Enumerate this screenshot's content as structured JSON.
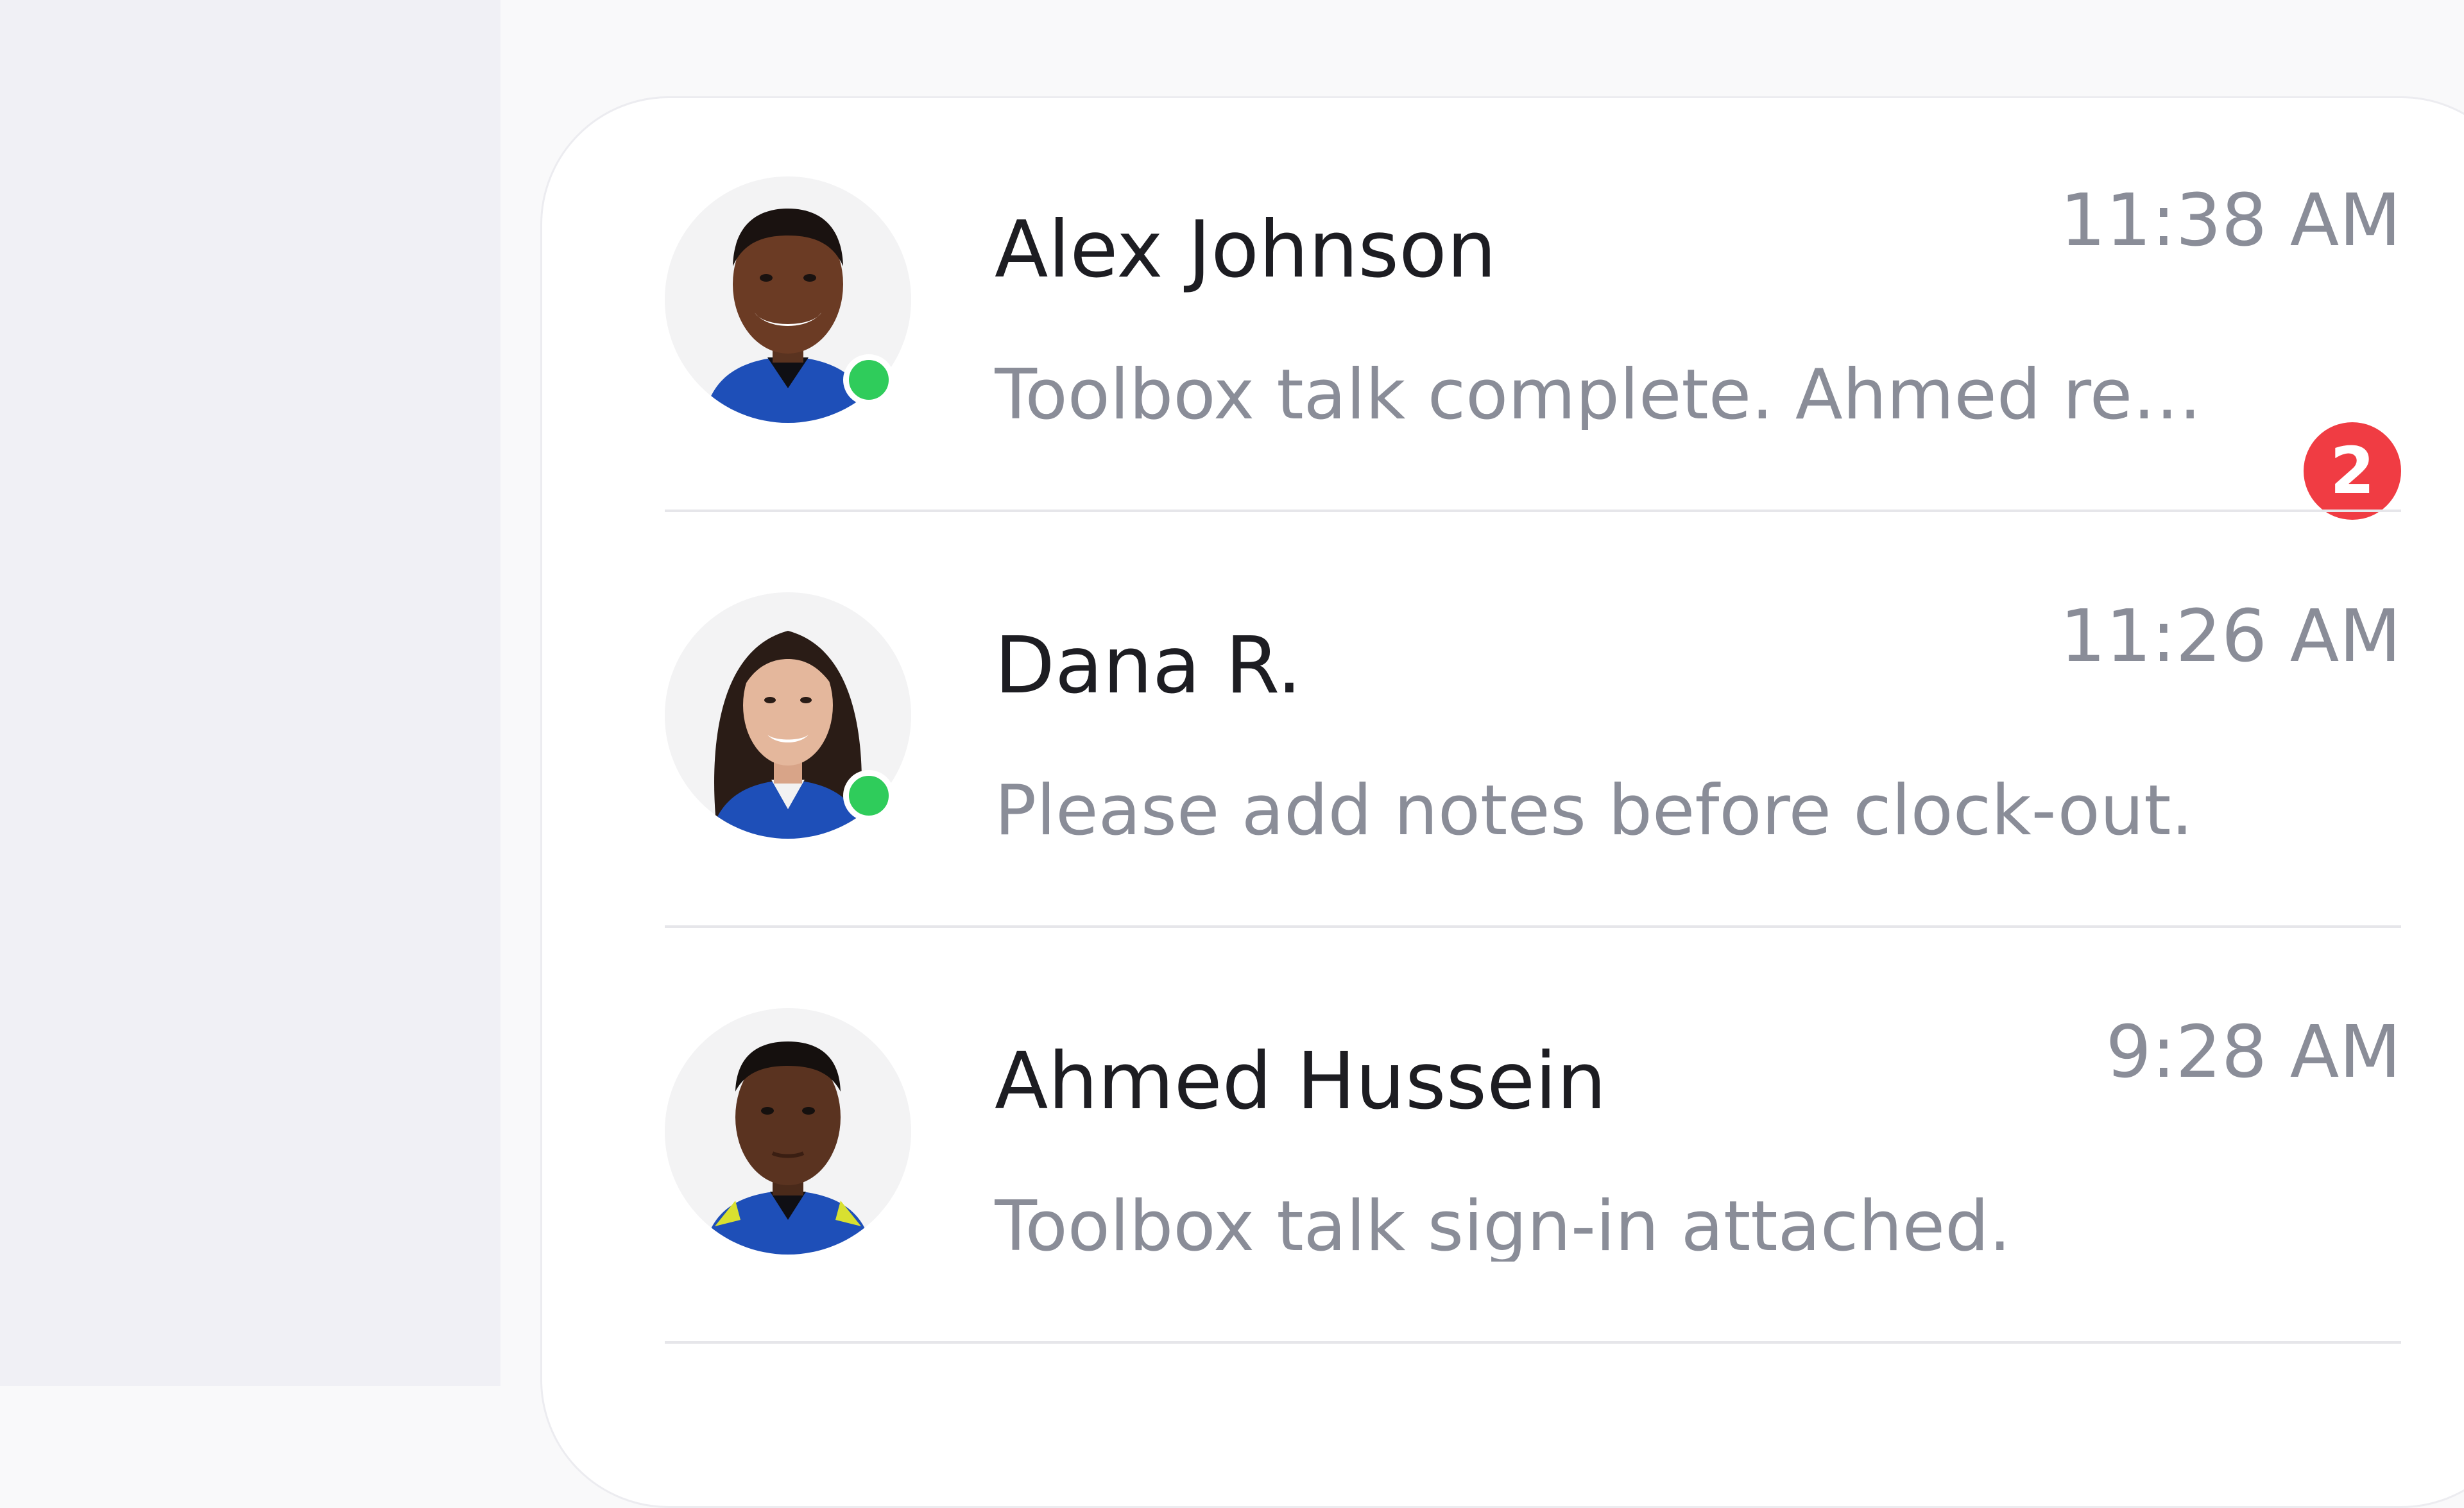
{
  "conversations": [
    {
      "name": "Alex Johnson",
      "time": "11:38 AM",
      "preview": "Toolbox talk complete. Ahmed revie...",
      "unread": "2",
      "online": true,
      "avatar": "man-avatar"
    },
    {
      "name": "Dana R.",
      "time": "11:26 AM",
      "preview": "Please add notes before clock-out.",
      "online": true,
      "avatar": "woman-avatar"
    },
    {
      "name": "Ahmed Hussein",
      "time": "9:28 AM",
      "preview": "Toolbox talk sign-in attached.",
      "online": false,
      "avatar": "man-avatar"
    }
  ],
  "colors": {
    "online": "#2fcc5b",
    "unread_badge": "#f03c43",
    "name_text": "#1d1d22",
    "muted_text": "#8a8d98",
    "shirt": "#1e4fb8"
  }
}
